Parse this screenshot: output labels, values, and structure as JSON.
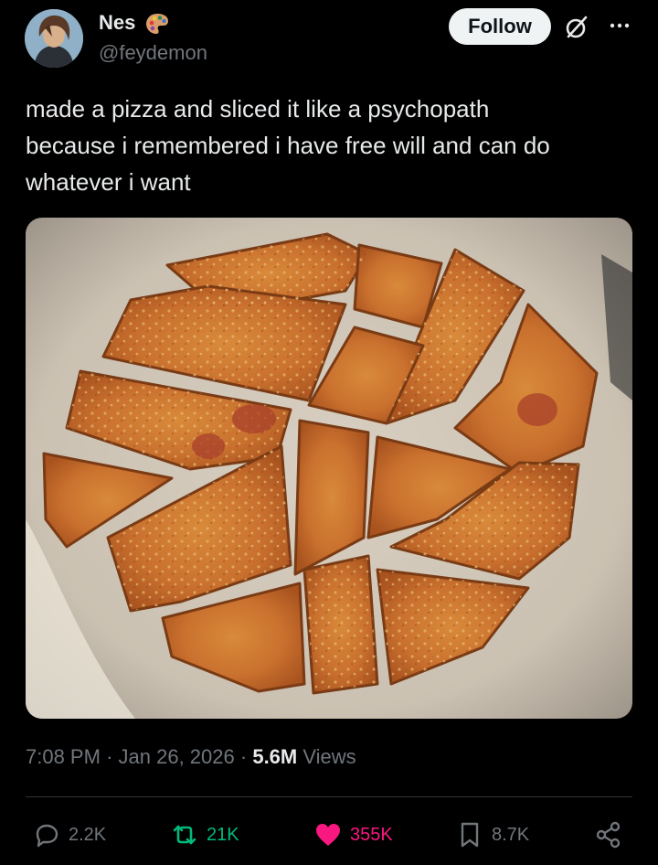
{
  "author": {
    "name": "Nes",
    "handle": "@feydemon",
    "avatar_icon": "anime-character-avatar",
    "name_emoji_icon": "artist-palette-icon"
  },
  "header": {
    "follow_label": "Follow",
    "grok_icon": "grok-icon",
    "more_icon": "more-dots-icon"
  },
  "tweet": {
    "lines": [
      "made a pizza and sliced it like a psychopath",
      "because i remembered i have free will and can do",
      "whatever i want"
    ],
    "media_icon": "pizza-photo"
  },
  "meta": {
    "time": "7:08 PM",
    "date": "Jan 26, 2026",
    "separator": "·",
    "views_count": "5.6M",
    "views_label": "Views"
  },
  "actions": {
    "replies": "2.2K",
    "reposts": "21K",
    "likes": "355K",
    "bookmarks": "8.7K"
  },
  "colors": {
    "background": "#000000",
    "text_primary": "#e7e9ea",
    "text_secondary": "#71767b",
    "repost_active": "#00ba7c",
    "like_active": "#f91880",
    "follow_bg": "#eff3f4"
  }
}
